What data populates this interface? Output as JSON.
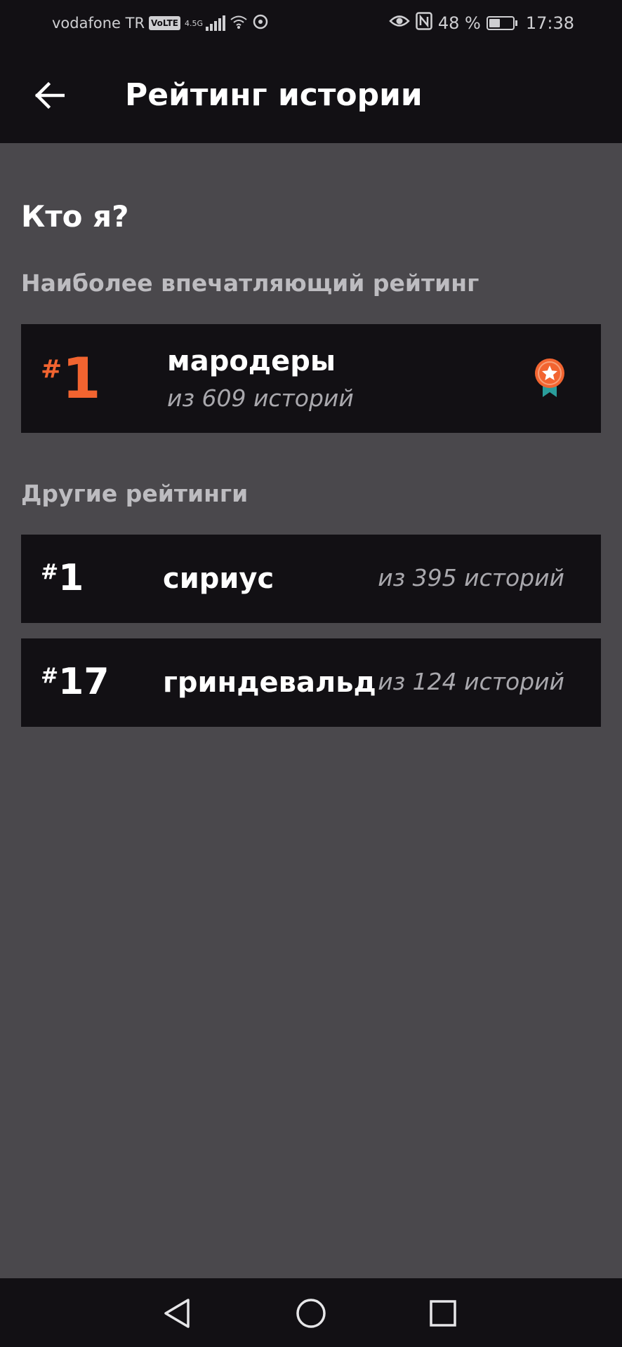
{
  "status_bar": {
    "carrier": "vodafone TR",
    "volte": "VoLTE",
    "network_type": "4.5G",
    "battery_percent": "48 %",
    "battery_level": 0.48,
    "time": "17:38"
  },
  "app_bar": {
    "title": "Рейтинг истории"
  },
  "story": {
    "title": "Кто я?"
  },
  "featured": {
    "section_label": "Наиболее впечатляющий рейтинг",
    "hash": "#",
    "rank": "1",
    "house": "мародеры",
    "count": "из 609 историй",
    "badge_icon": "award-ribbon-icon"
  },
  "others": {
    "section_label": "Другие рейтинги",
    "items": [
      {
        "hash": "#",
        "rank": "1",
        "house": "сириус",
        "count": "из 395 историй"
      },
      {
        "hash": "#",
        "rank": "17",
        "house": "гриндевальд",
        "count": "из 124 историй"
      }
    ]
  },
  "colors": {
    "accent": "#f26430",
    "badge_ribbon": "#2a9d9b",
    "background": "#4a484c",
    "card": "#121014"
  }
}
